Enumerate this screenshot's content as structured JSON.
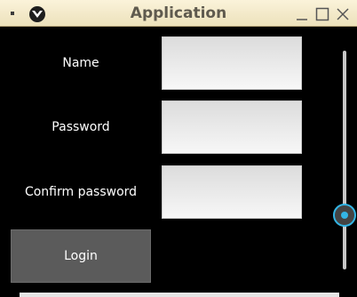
{
  "window": {
    "title": "Application"
  },
  "form": {
    "name_label": "Name",
    "name_value": "",
    "password_label": "Password",
    "password_value": "",
    "confirm_label": "Confirm password",
    "confirm_value": "",
    "login_label": "Login"
  },
  "slider": {
    "value_fraction": 0.75
  },
  "colors": {
    "accent": "#33b5e5",
    "titlebar": "#f4ead0",
    "background": "#000000"
  }
}
